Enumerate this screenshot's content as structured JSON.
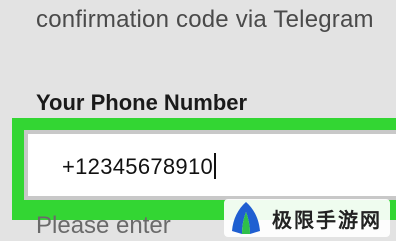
{
  "intro": {
    "text": "confirmation code via Telegram"
  },
  "phone_field": {
    "label": "Your Phone Number",
    "value": "+12345678910"
  },
  "hint": {
    "text": "Please enter"
  },
  "colors": {
    "highlight": "#33d633",
    "background": "#e3e3e3",
    "input_bg": "#ffffff"
  },
  "watermark": {
    "text": "极限手游网",
    "logo_icon": "shield-logo-icon"
  }
}
